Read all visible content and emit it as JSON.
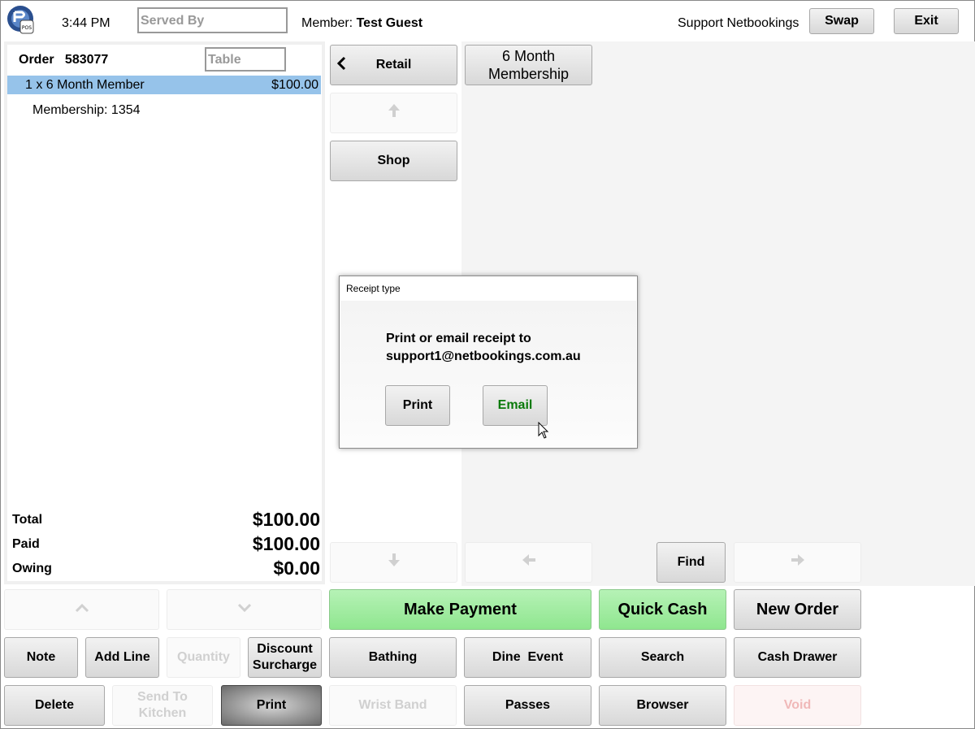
{
  "header": {
    "time": "3:44 PM",
    "served_by_placeholder": "Served By",
    "member_label": "Member:",
    "member_name": "Test Guest",
    "user": "Support Netbookings",
    "swap": "Swap",
    "exit": "Exit"
  },
  "order": {
    "label": "Order",
    "number": "583077",
    "table_placeholder": "Table",
    "line_item": {
      "desc": "1 x 6 Month Member",
      "price": "$100.00"
    },
    "sub_item": "Membership: 1354",
    "totals": {
      "total_label": "Total",
      "total_value": "$100.00",
      "paid_label": "Paid",
      "paid_value": "$100.00",
      "owing_label": "Owing",
      "owing_value": "$0.00"
    }
  },
  "categories": {
    "retail": "Retail",
    "shop": "Shop",
    "product_6month": "6 Month Membership",
    "find": "Find"
  },
  "dialog": {
    "title": "Receipt type",
    "message_line1": "Print or email receipt to",
    "message_line2": "support1@netbookings.com.au",
    "print": "Print",
    "email": "Email"
  },
  "actions": {
    "note": "Note",
    "add_line": "Add Line",
    "quantity": "Quantity",
    "discount_line1": "Discount",
    "discount_line2": "Surcharge",
    "delete": "Delete",
    "send_to_kitchen": "Send To Kitchen",
    "print": "Print",
    "make_payment": "Make Payment",
    "quick_cash": "Quick Cash",
    "new_order": "New Order",
    "bathing": "Bathing",
    "dine_event": "Dine  Event",
    "search": "Search",
    "cash_drawer": "Cash Drawer",
    "wrist_band": "Wrist Band",
    "passes": "Passes",
    "browser": "Browser",
    "void": "Void"
  },
  "colors": {
    "selected_row": "#96c3ea",
    "payment_green": "#8fe68f",
    "email_text": "#0a7a0a"
  },
  "icons": {
    "back": "chevron-left-icon",
    "up": "arrow-up-icon",
    "down": "arrow-down-icon",
    "left": "arrow-left-icon",
    "right": "arrow-right-icon"
  }
}
